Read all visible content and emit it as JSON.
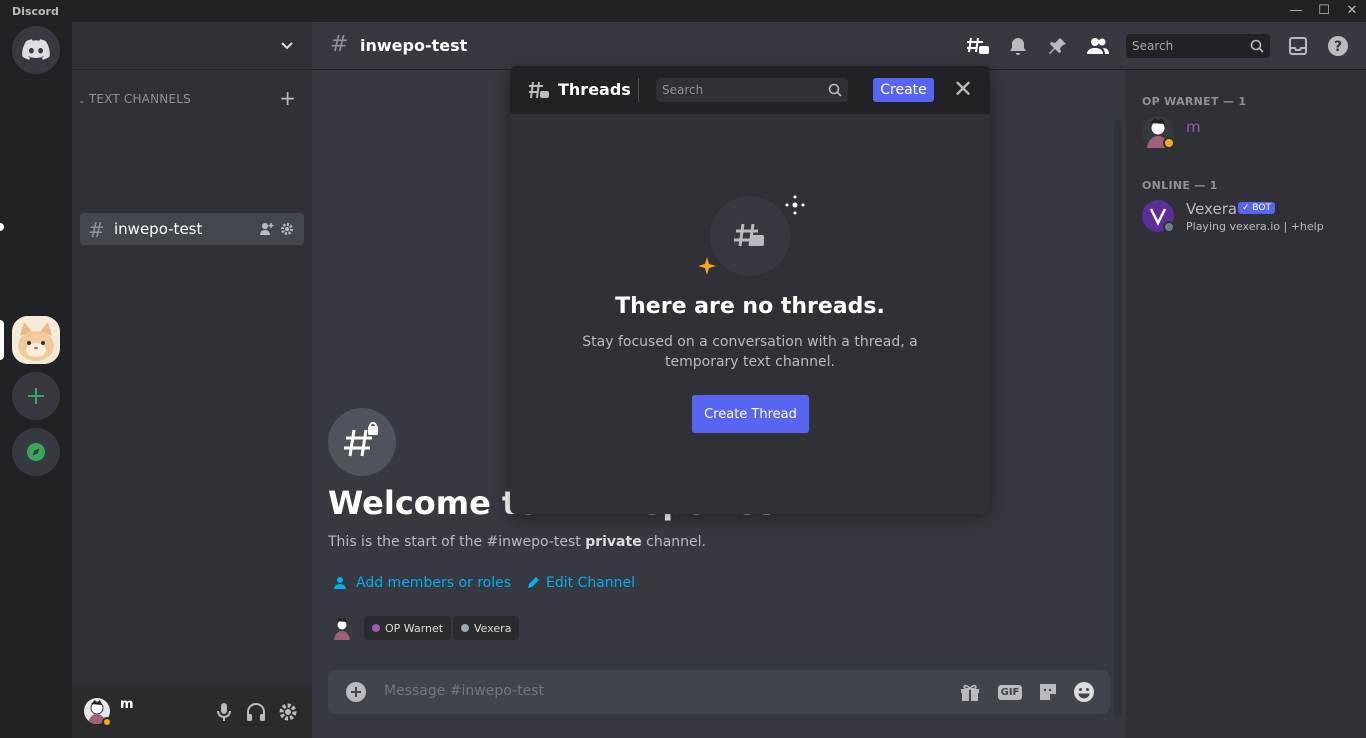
{
  "window": {
    "app_name": "Discord",
    "minimize": "—",
    "maximize": "☐",
    "close": "✕"
  },
  "sidebar": {
    "category": "TEXT CHANNELS",
    "channel": {
      "name": "inwepo-test"
    },
    "user": {
      "name": "m"
    }
  },
  "header": {
    "channel_name": "inwepo-test",
    "search_placeholder": "Search"
  },
  "threads_popup": {
    "title": "Threads",
    "search_placeholder": "Search",
    "create_label": "Create",
    "empty_title": "There are no threads.",
    "empty_sub": "Stay focused on a conversation with a thread, a temporary text channel.",
    "create_thread_label": "Create Thread"
  },
  "welcome": {
    "title": "Welcome to #inwepo-test",
    "sub_prefix": "This is the start of the #inwepo-test ",
    "sub_bold": "private",
    "sub_suffix": " channel.",
    "add_members": "Add members or roles",
    "edit_channel": "Edit Channel",
    "roles": [
      {
        "name": "OP Warnet",
        "color": "#9b59b6"
      },
      {
        "name": "Vexera",
        "color": "#99aab5"
      }
    ]
  },
  "composer": {
    "placeholder": "Message #inwepo-test",
    "gif_label": "GIF"
  },
  "members": {
    "group1_title": "OP WARNET — 1",
    "group1_member": "m",
    "group2_title": "ONLINE — 1",
    "group2_member": "Vexera",
    "bot_badge": "✓ BOT",
    "group2_status": "Playing vexera.io | +help"
  },
  "colors": {
    "accent": "#5865f2",
    "link": "#00aff4",
    "role_purple": "#9b59b6"
  }
}
